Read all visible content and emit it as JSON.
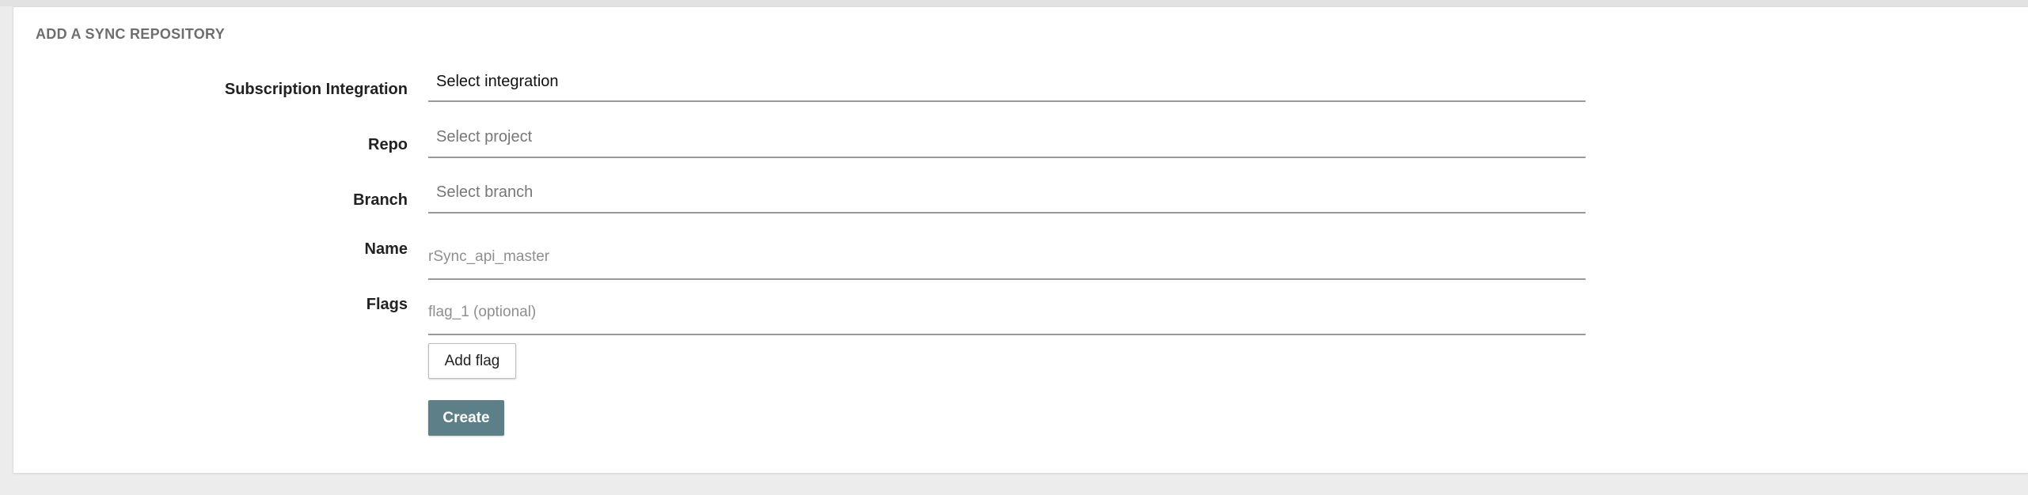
{
  "panel": {
    "title": "ADD A SYNC REPOSITORY"
  },
  "form": {
    "subscription_integration": {
      "label": "Subscription Integration",
      "value": "Select integration"
    },
    "repo": {
      "label": "Repo",
      "value": "Select project"
    },
    "branch": {
      "label": "Branch",
      "value": "Select branch"
    },
    "name": {
      "label": "Name",
      "placeholder": "rSync_api_master"
    },
    "flags": {
      "label": "Flags",
      "placeholder": "flag_1 (optional)"
    }
  },
  "buttons": {
    "add_flag": "Add flag",
    "create": "Create"
  },
  "colors": {
    "create_button": "#5c7f88",
    "page_background": "#ececec",
    "panel_background": "#ffffff"
  }
}
